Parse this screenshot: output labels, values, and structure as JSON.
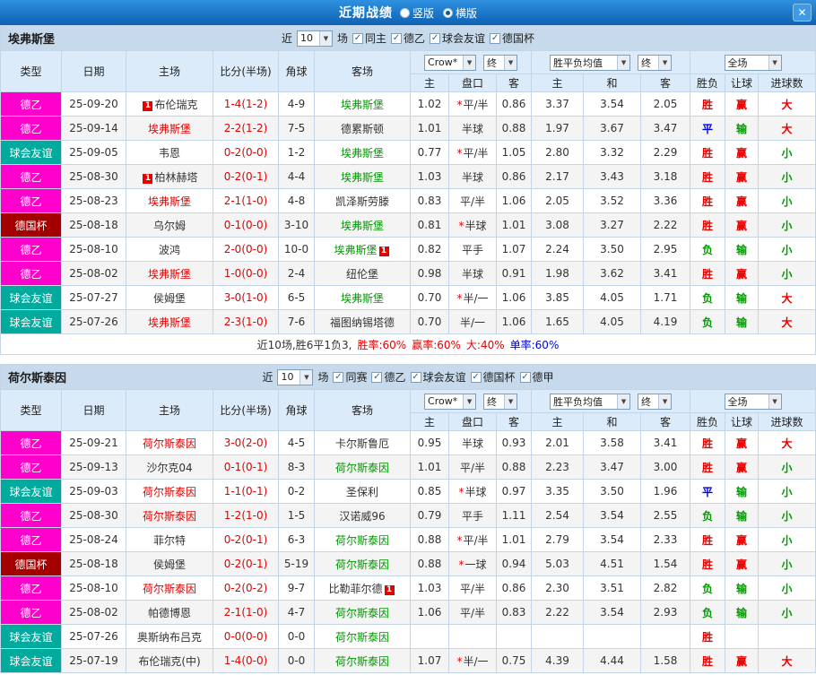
{
  "titlebar": {
    "title": "近期战绩",
    "radios": [
      {
        "label": "竖版",
        "checked": false
      },
      {
        "label": "横版",
        "checked": true
      }
    ],
    "close_icon": "✕"
  },
  "table_headers": {
    "type": "类型",
    "date": "日期",
    "home": "主场",
    "score": "比分(半场)",
    "corners": "角球",
    "away": "客场",
    "odds_select": "Crow*",
    "odds_final_select": "终",
    "avg_select": "胜平负均值",
    "avg_final_select": "终",
    "full_select": "全场",
    "sub": [
      "主",
      "盘口",
      "客",
      "主",
      "和",
      "客",
      "胜负",
      "让球",
      "进球数"
    ]
  },
  "colors": {
    "titlebar_top": "#2f90e0",
    "titlebar_bottom": "#0e61b2",
    "section_header_bg": "#c6daec",
    "table_header_bg": "#dcebfa",
    "table_border": "#c3d5e6",
    "score": "#e60000",
    "badge": "#e60000",
    "team_home": "#e60000",
    "team_away": "#009900",
    "league": {
      "德乙": "#ff00cc",
      "球会友谊": "#00ab9e",
      "德国杯": "#a40000"
    },
    "result": {
      "red": "#e60000",
      "blue": "#0000e0",
      "green": "#009900"
    }
  },
  "sections": [
    {
      "team": "埃弗斯堡",
      "filter": {
        "near": "近",
        "count": "10",
        "games": "场",
        "checkboxes": [
          {
            "label": "同主",
            "checked": true
          },
          {
            "label": "德乙",
            "checked": true
          },
          {
            "label": "球会友谊",
            "checked": true
          },
          {
            "label": "德国杯",
            "checked": true
          }
        ]
      },
      "rows": [
        {
          "league": "德乙",
          "date": "25-09-20",
          "home": "布伦瑞克",
          "home_focus": false,
          "home_badge": "1",
          "score": "1-4(1-2)",
          "corners": "4-9",
          "away": "埃弗斯堡",
          "away_focus": true,
          "away_badge": "",
          "odds": [
            "1.02",
            "*平/半",
            "0.86"
          ],
          "avg": [
            "3.37",
            "3.54",
            "2.05"
          ],
          "results": [
            [
              "胜",
              "red"
            ],
            [
              "赢",
              "red"
            ],
            [
              "大",
              "red"
            ]
          ]
        },
        {
          "league": "德乙",
          "date": "25-09-14",
          "home": "埃弗斯堡",
          "home_focus": true,
          "home_badge": "",
          "score": "2-2(1-2)",
          "corners": "7-5",
          "away": "德累斯顿",
          "away_focus": false,
          "away_badge": "",
          "odds": [
            "1.01",
            "半球",
            "0.88"
          ],
          "avg": [
            "1.97",
            "3.67",
            "3.47"
          ],
          "results": [
            [
              "平",
              "blue"
            ],
            [
              "输",
              "green"
            ],
            [
              "大",
              "red"
            ]
          ]
        },
        {
          "league": "球会友谊",
          "date": "25-09-05",
          "home": "韦恩",
          "home_focus": false,
          "home_badge": "",
          "score": "0-2(0-0)",
          "corners": "1-2",
          "away": "埃弗斯堡",
          "away_focus": true,
          "away_badge": "",
          "odds": [
            "0.77",
            "*平/半",
            "1.05"
          ],
          "avg": [
            "2.80",
            "3.32",
            "2.29"
          ],
          "results": [
            [
              "胜",
              "red"
            ],
            [
              "赢",
              "red"
            ],
            [
              "小",
              "green"
            ]
          ]
        },
        {
          "league": "德乙",
          "date": "25-08-30",
          "home": "柏林赫塔",
          "home_focus": false,
          "home_badge": "1",
          "score": "0-2(0-1)",
          "corners": "4-4",
          "away": "埃弗斯堡",
          "away_focus": true,
          "away_badge": "",
          "odds": [
            "1.03",
            "半球",
            "0.86"
          ],
          "avg": [
            "2.17",
            "3.43",
            "3.18"
          ],
          "results": [
            [
              "胜",
              "red"
            ],
            [
              "赢",
              "red"
            ],
            [
              "小",
              "green"
            ]
          ]
        },
        {
          "league": "德乙",
          "date": "25-08-23",
          "home": "埃弗斯堡",
          "home_focus": true,
          "home_badge": "",
          "score": "2-1(1-0)",
          "corners": "4-8",
          "away": "凯泽斯劳滕",
          "away_focus": false,
          "away_badge": "",
          "odds": [
            "0.83",
            "平/半",
            "1.06"
          ],
          "avg": [
            "2.05",
            "3.52",
            "3.36"
          ],
          "results": [
            [
              "胜",
              "red"
            ],
            [
              "赢",
              "red"
            ],
            [
              "小",
              "green"
            ]
          ]
        },
        {
          "league": "德国杯",
          "date": "25-08-18",
          "home": "乌尔姆",
          "home_focus": false,
          "home_badge": "",
          "score": "0-1(0-0)",
          "corners": "3-10",
          "away": "埃弗斯堡",
          "away_focus": true,
          "away_badge": "",
          "odds": [
            "0.81",
            "*半球",
            "1.01"
          ],
          "avg": [
            "3.08",
            "3.27",
            "2.22"
          ],
          "results": [
            [
              "胜",
              "red"
            ],
            [
              "赢",
              "red"
            ],
            [
              "小",
              "green"
            ]
          ]
        },
        {
          "league": "德乙",
          "date": "25-08-10",
          "home": "波鸿",
          "home_focus": false,
          "home_badge": "",
          "score": "2-0(0-0)",
          "corners": "10-0",
          "away": "埃弗斯堡",
          "away_focus": true,
          "away_badge": "1",
          "odds": [
            "0.82",
            "平手",
            "1.07"
          ],
          "avg": [
            "2.24",
            "3.50",
            "2.95"
          ],
          "results": [
            [
              "负",
              "green"
            ],
            [
              "输",
              "green"
            ],
            [
              "小",
              "green"
            ]
          ]
        },
        {
          "league": "德乙",
          "date": "25-08-02",
          "home": "埃弗斯堡",
          "home_focus": true,
          "home_badge": "",
          "score": "1-0(0-0)",
          "corners": "2-4",
          "away": "纽伦堡",
          "away_focus": false,
          "away_badge": "",
          "odds": [
            "0.98",
            "半球",
            "0.91"
          ],
          "avg": [
            "1.98",
            "3.62",
            "3.41"
          ],
          "results": [
            [
              "胜",
              "red"
            ],
            [
              "赢",
              "red"
            ],
            [
              "小",
              "green"
            ]
          ]
        },
        {
          "league": "球会友谊",
          "date": "25-07-27",
          "home": "侯姆堡",
          "home_focus": false,
          "home_badge": "",
          "score": "3-0(1-0)",
          "corners": "6-5",
          "away": "埃弗斯堡",
          "away_focus": true,
          "away_badge": "",
          "odds": [
            "0.70",
            "*半/一",
            "1.06"
          ],
          "avg": [
            "3.85",
            "4.05",
            "1.71"
          ],
          "results": [
            [
              "负",
              "green"
            ],
            [
              "输",
              "green"
            ],
            [
              "大",
              "red"
            ]
          ]
        },
        {
          "league": "球会友谊",
          "date": "25-07-26",
          "home": "埃弗斯堡",
          "home_focus": true,
          "home_badge": "",
          "score": "2-3(1-0)",
          "corners": "7-6",
          "away": "福图纳锡塔德",
          "away_focus": false,
          "away_badge": "",
          "odds": [
            "0.70",
            "半/一",
            "1.06"
          ],
          "avg": [
            "1.65",
            "4.05",
            "4.19"
          ],
          "results": [
            [
              "负",
              "green"
            ],
            [
              "输",
              "green"
            ],
            [
              "大",
              "red"
            ]
          ]
        }
      ],
      "footer": {
        "summary": "近10场,胜6平1负3,",
        "parts": [
          [
            "胜率:60%",
            "red"
          ],
          [
            "赢率:60%",
            "red"
          ],
          [
            "大:40%",
            "red"
          ],
          [
            "单率:60%",
            "blue"
          ]
        ]
      }
    },
    {
      "team": "荷尔斯泰因",
      "filter": {
        "near": "近",
        "count": "10",
        "games": "场",
        "checkboxes": [
          {
            "label": "同赛",
            "checked": true
          },
          {
            "label": "德乙",
            "checked": true
          },
          {
            "label": "球会友谊",
            "checked": true
          },
          {
            "label": "德国杯",
            "checked": true
          },
          {
            "label": "德甲",
            "checked": true
          }
        ]
      },
      "rows": [
        {
          "league": "德乙",
          "date": "25-09-21",
          "home": "荷尔斯泰因",
          "home_focus": true,
          "home_badge": "",
          "score": "3-0(2-0)",
          "corners": "4-5",
          "away": "卡尔斯鲁厄",
          "away_focus": false,
          "away_badge": "",
          "odds": [
            "0.95",
            "半球",
            "0.93"
          ],
          "avg": [
            "2.01",
            "3.58",
            "3.41"
          ],
          "results": [
            [
              "胜",
              "red"
            ],
            [
              "赢",
              "red"
            ],
            [
              "大",
              "red"
            ]
          ]
        },
        {
          "league": "德乙",
          "date": "25-09-13",
          "home": "沙尔克04",
          "home_focus": false,
          "home_badge": "",
          "score": "0-1(0-1)",
          "corners": "8-3",
          "away": "荷尔斯泰因",
          "away_focus": true,
          "away_badge": "",
          "odds": [
            "1.01",
            "平/半",
            "0.88"
          ],
          "avg": [
            "2.23",
            "3.47",
            "3.00"
          ],
          "results": [
            [
              "胜",
              "red"
            ],
            [
              "赢",
              "red"
            ],
            [
              "小",
              "green"
            ]
          ]
        },
        {
          "league": "球会友谊",
          "date": "25-09-03",
          "home": "荷尔斯泰因",
          "home_focus": true,
          "home_badge": "",
          "score": "1-1(0-1)",
          "corners": "0-2",
          "away": "圣保利",
          "away_focus": false,
          "away_badge": "",
          "odds": [
            "0.85",
            "*半球",
            "0.97"
          ],
          "avg": [
            "3.35",
            "3.50",
            "1.96"
          ],
          "results": [
            [
              "平",
              "blue"
            ],
            [
              "输",
              "green"
            ],
            [
              "小",
              "green"
            ]
          ]
        },
        {
          "league": "德乙",
          "date": "25-08-30",
          "home": "荷尔斯泰因",
          "home_focus": true,
          "home_badge": "",
          "score": "1-2(1-0)",
          "corners": "1-5",
          "away": "汉诺威96",
          "away_focus": false,
          "away_badge": "",
          "odds": [
            "0.79",
            "平手",
            "1.11"
          ],
          "avg": [
            "2.54",
            "3.54",
            "2.55"
          ],
          "results": [
            [
              "负",
              "green"
            ],
            [
              "输",
              "green"
            ],
            [
              "小",
              "green"
            ]
          ]
        },
        {
          "league": "德乙",
          "date": "25-08-24",
          "home": "菲尔特",
          "home_focus": false,
          "home_badge": "",
          "score": "0-2(0-1)",
          "corners": "6-3",
          "away": "荷尔斯泰因",
          "away_focus": true,
          "away_badge": "",
          "odds": [
            "0.88",
            "*平/半",
            "1.01"
          ],
          "avg": [
            "2.79",
            "3.54",
            "2.33"
          ],
          "results": [
            [
              "胜",
              "red"
            ],
            [
              "赢",
              "red"
            ],
            [
              "小",
              "green"
            ]
          ]
        },
        {
          "league": "德国杯",
          "date": "25-08-18",
          "home": "侯姆堡",
          "home_focus": false,
          "home_badge": "",
          "score": "0-2(0-1)",
          "corners": "5-19",
          "away": "荷尔斯泰因",
          "away_focus": true,
          "away_badge": "",
          "odds": [
            "0.88",
            "*一球",
            "0.94"
          ],
          "avg": [
            "5.03",
            "4.51",
            "1.54"
          ],
          "results": [
            [
              "胜",
              "red"
            ],
            [
              "赢",
              "red"
            ],
            [
              "小",
              "green"
            ]
          ]
        },
        {
          "league": "德乙",
          "date": "25-08-10",
          "home": "荷尔斯泰因",
          "home_focus": true,
          "home_badge": "",
          "score": "0-2(0-2)",
          "corners": "9-7",
          "away": "比勒菲尔德",
          "away_focus": false,
          "away_badge": "1",
          "odds": [
            "1.03",
            "平/半",
            "0.86"
          ],
          "avg": [
            "2.30",
            "3.51",
            "2.82"
          ],
          "results": [
            [
              "负",
              "green"
            ],
            [
              "输",
              "green"
            ],
            [
              "小",
              "green"
            ]
          ]
        },
        {
          "league": "德乙",
          "date": "25-08-02",
          "home": "帕德博恩",
          "home_focus": false,
          "home_badge": "",
          "score": "2-1(1-0)",
          "corners": "4-7",
          "away": "荷尔斯泰因",
          "away_focus": true,
          "away_badge": "",
          "odds": [
            "1.06",
            "平/半",
            "0.83"
          ],
          "avg": [
            "2.22",
            "3.54",
            "2.93"
          ],
          "results": [
            [
              "负",
              "green"
            ],
            [
              "输",
              "green"
            ],
            [
              "小",
              "green"
            ]
          ]
        },
        {
          "league": "球会友谊",
          "date": "25-07-26",
          "home": "奥斯纳布吕克",
          "home_focus": false,
          "home_badge": "",
          "score": "0-0(0-0)",
          "corners": "0-0",
          "away": "荷尔斯泰因",
          "away_focus": true,
          "away_badge": "",
          "odds": [
            "",
            "",
            ""
          ],
          "avg": [
            "",
            "",
            ""
          ],
          "results": [
            [
              "胜",
              "red"
            ],
            [
              "",
              ""
            ],
            [
              "",
              ""
            ]
          ]
        },
        {
          "league": "球会友谊",
          "date": "25-07-19",
          "home": "布伦瑞克(中)",
          "home_focus": false,
          "home_badge": "",
          "score": "1-4(0-0)",
          "corners": "0-0",
          "away": "荷尔斯泰因",
          "away_focus": true,
          "away_badge": "",
          "odds": [
            "1.07",
            "*半/一",
            "0.75"
          ],
          "avg": [
            "4.39",
            "4.44",
            "1.58"
          ],
          "results": [
            [
              "胜",
              "red"
            ],
            [
              "赢",
              "red"
            ],
            [
              "大",
              "red"
            ]
          ]
        }
      ]
    }
  ]
}
